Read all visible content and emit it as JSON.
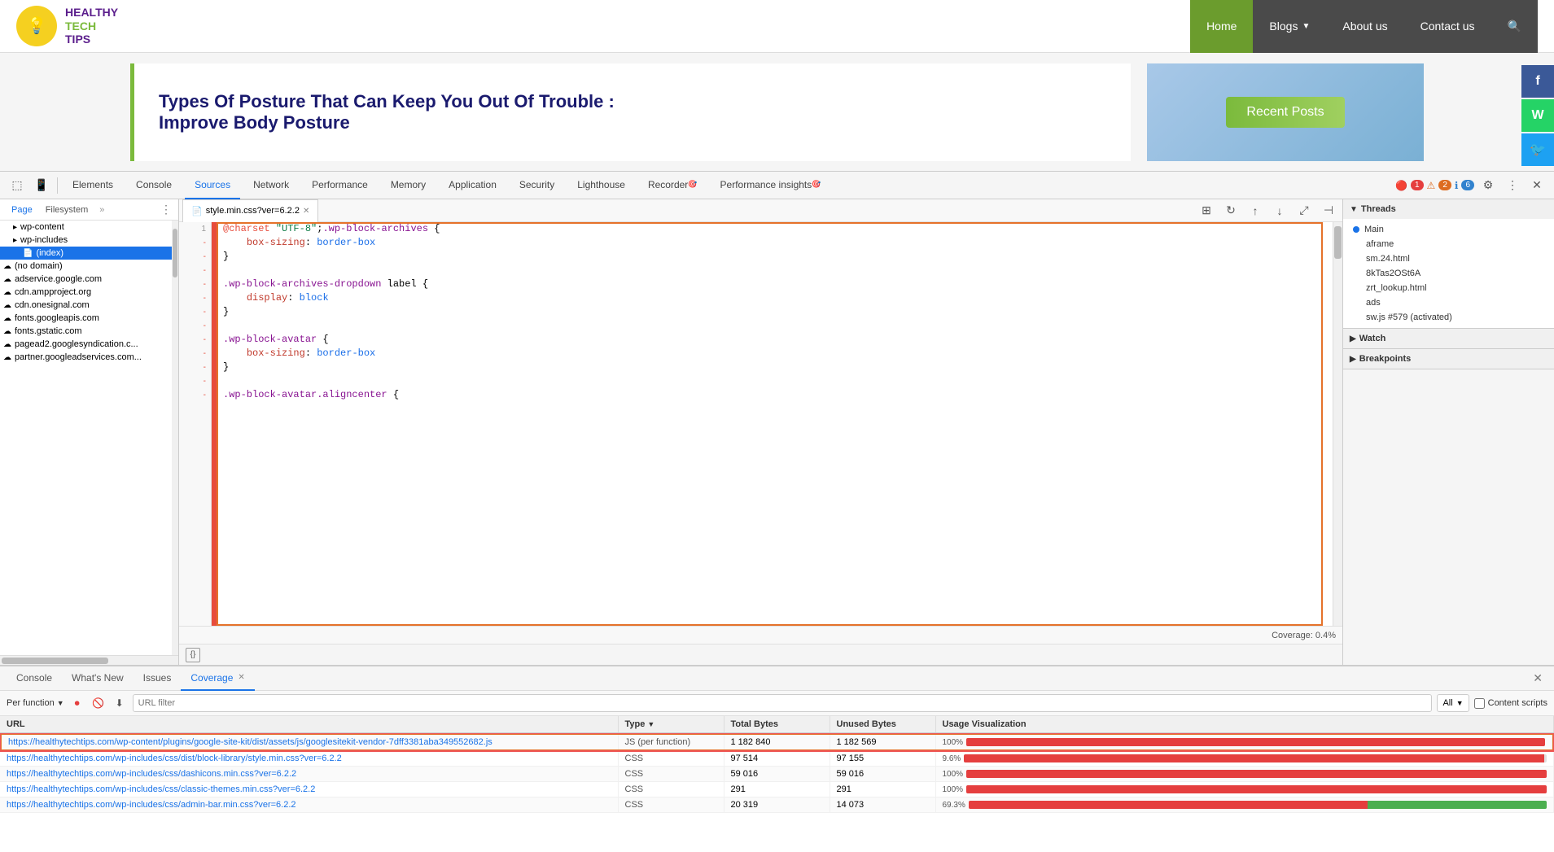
{
  "website": {
    "logo": {
      "icon": "💡",
      "line1": "HEALTHY",
      "line2": "TECH",
      "line3": "TIPS"
    },
    "nav": {
      "items": [
        {
          "label": "Home",
          "active": true
        },
        {
          "label": "Blogs",
          "hasDropdown": true
        },
        {
          "label": "About us",
          "active": false
        },
        {
          "label": "Contact us",
          "active": false
        }
      ],
      "search_icon": "🔍"
    },
    "article": {
      "title": "Types Of Posture That Can Keep You Out Of Trouble :",
      "subtitle": "Improve Body Posture"
    },
    "recent_posts_label": "Recent Posts"
  },
  "social": [
    {
      "label": "f",
      "type": "facebook"
    },
    {
      "label": "W",
      "type": "whatsapp"
    },
    {
      "label": "🐦",
      "type": "twitter"
    }
  ],
  "devtools": {
    "toolbar": {
      "inspect_icon": "⬚",
      "device_icon": "📱",
      "tabs": [
        "Elements",
        "Console",
        "Sources",
        "Network",
        "Performance",
        "Memory",
        "Application",
        "Security",
        "Lighthouse",
        "Recorder",
        "Performance insights"
      ],
      "active_tab": "Sources",
      "errors": "1",
      "warnings": "2",
      "info": "6",
      "settings_icon": "⚙",
      "more_icon": "⋮",
      "close_icon": "✕"
    },
    "file_tree": {
      "tabs": [
        "Page",
        "Filesystem"
      ],
      "items": [
        {
          "label": "wp-content",
          "depth": 1,
          "type": "folder",
          "expanded": true
        },
        {
          "label": "wp-includes",
          "depth": 1,
          "type": "folder",
          "expanded": true
        },
        {
          "label": "(index)",
          "depth": 2,
          "type": "file",
          "selected": true
        },
        {
          "label": "(no domain)",
          "depth": 0,
          "type": "cloud"
        },
        {
          "label": "adservice.google.com",
          "depth": 0,
          "type": "cloud"
        },
        {
          "label": "cdn.ampproject.org",
          "depth": 0,
          "type": "cloud"
        },
        {
          "label": "cdn.onesignal.com",
          "depth": 0,
          "type": "cloud"
        },
        {
          "label": "fonts.googleapis.com",
          "depth": 0,
          "type": "cloud"
        },
        {
          "label": "fonts.gstatic.com",
          "depth": 0,
          "type": "cloud"
        },
        {
          "label": "pagead2.googlesyndication.c...",
          "depth": 0,
          "type": "cloud"
        },
        {
          "label": "partner.googleadservices.com...",
          "depth": 0,
          "type": "cloud"
        }
      ]
    },
    "code_editor": {
      "tab_label": "style.min.css?ver=6.2.2",
      "lines": [
        {
          "num": 1,
          "marker": "-",
          "code": "@charset \"UTF-8\";.wp-block-archives {",
          "parts": [
            {
              "text": "@charset ",
              "cls": "kw-charset"
            },
            {
              "text": "\"UTF-8\"",
              "cls": "kw-string"
            },
            {
              "text": ";",
              "cls": ""
            },
            {
              "text": ".wp-block-archives",
              "cls": "kw-selector"
            },
            {
              "text": " {",
              "cls": "kw-brace"
            }
          ]
        },
        {
          "num": 2,
          "marker": "-",
          "code": "    box-sizing: border-box",
          "parts": [
            {
              "text": "    ",
              "cls": ""
            },
            {
              "text": "box-sizing",
              "cls": "kw-property"
            },
            {
              "text": ": ",
              "cls": ""
            },
            {
              "text": "border-box",
              "cls": "kw-value"
            }
          ]
        },
        {
          "num": 3,
          "marker": "-",
          "code": "}",
          "parts": [
            {
              "text": "}",
              "cls": "kw-brace"
            }
          ]
        },
        {
          "num": "",
          "marker": "-",
          "code": "",
          "parts": []
        },
        {
          "num": "",
          "marker": "-",
          "code": ".wp-block-archives-dropdown label {",
          "parts": [
            {
              "text": ".wp-block-archives-dropdown",
              "cls": "kw-selector"
            },
            {
              "text": " label",
              "cls": "kw-selector"
            },
            {
              "text": " {",
              "cls": "kw-brace"
            }
          ]
        },
        {
          "num": "",
          "marker": "-",
          "code": "    display: block",
          "parts": [
            {
              "text": "    ",
              "cls": ""
            },
            {
              "text": "display",
              "cls": "kw-property"
            },
            {
              "text": ": ",
              "cls": ""
            },
            {
              "text": "block",
              "cls": "kw-value"
            }
          ]
        },
        {
          "num": "",
          "marker": "-",
          "code": "}",
          "parts": [
            {
              "text": "}",
              "cls": "kw-brace"
            }
          ]
        },
        {
          "num": "",
          "marker": "-",
          "code": "",
          "parts": []
        },
        {
          "num": "",
          "marker": "-",
          "code": ".wp-block-avatar {",
          "parts": [
            {
              "text": ".wp-block-avatar",
              "cls": "kw-selector"
            },
            {
              "text": " {",
              "cls": "kw-brace"
            }
          ]
        },
        {
          "num": "",
          "marker": "-",
          "code": "    box-sizing: border-box",
          "parts": [
            {
              "text": "    ",
              "cls": ""
            },
            {
              "text": "box-sizing",
              "cls": "kw-property"
            },
            {
              "text": ": ",
              "cls": ""
            },
            {
              "text": "border-box",
              "cls": "kw-value"
            }
          ]
        },
        {
          "num": "",
          "marker": "-",
          "code": "}",
          "parts": [
            {
              "text": "}",
              "cls": "kw-brace"
            }
          ]
        },
        {
          "num": "",
          "marker": "-",
          "code": "",
          "parts": []
        },
        {
          "num": "",
          "marker": "-",
          "code": ".wp-block-avatar.aligncenter {",
          "parts": [
            {
              "text": ".wp-block-avatar.aligncenter",
              "cls": "kw-selector"
            },
            {
              "text": " {",
              "cls": "kw-brace"
            }
          ]
        }
      ],
      "coverage_label": "Coverage: 0.4%",
      "format_icon": "{}"
    },
    "right_panel": {
      "threads": {
        "label": "Threads",
        "items": [
          "Main",
          "aframe",
          "sm.24.html",
          "8kTas2OSt6A",
          "zrt_lookup.html",
          "ads",
          "sw.js #579 (activated)"
        ]
      },
      "watch": {
        "label": "Watch"
      },
      "breakpoints": {
        "label": "Breakpoints"
      }
    }
  },
  "bottom_panel": {
    "tabs": [
      "Console",
      "What's New",
      "Issues",
      "Coverage"
    ],
    "active_tab": "Coverage",
    "toolbar": {
      "per_function_label": "Per function",
      "record_icon": "⏺",
      "clear_icon": "🚫",
      "download_icon": "⬇",
      "filter_placeholder": "URL filter",
      "filter_all": "All",
      "content_scripts_label": "Content scripts"
    },
    "table": {
      "headers": [
        "URL",
        "Type",
        "Total Bytes",
        "Unused Bytes",
        "Usage Visualization"
      ],
      "rows": [
        {
          "url": "https://healthytechtips.com/wp-content/plugins/google-site-kit/dist/assets/js/googlesitekit-vendor-7dff3381aba349552682.js",
          "type": "JS (per function)",
          "total_bytes": "1 182 840",
          "unused_bytes": "1 182 569",
          "unused_pct": 100,
          "highlighted": true
        },
        {
          "url": "https://healthytechtips.com/wp-includes/css/dist/block-library/style.min.css?ver=6.2.2",
          "type": "CSS",
          "total_bytes": "97 514",
          "unused_bytes": "97 155",
          "unused_pct": 99.6,
          "highlighted": false
        },
        {
          "url": "https://healthytechtips.com/wp-includes/css/dashicons.min.css?ver=6.2.2",
          "type": "CSS",
          "total_bytes": "59 016",
          "unused_bytes": "59 016",
          "unused_pct": 100,
          "highlighted": false
        },
        {
          "url": "https://healthytechtips.com/wp-includes/css/classic-themes.min.css?ver=6.2.2",
          "type": "CSS",
          "total_bytes": "291",
          "unused_bytes": "291",
          "unused_pct": 100,
          "highlighted": false
        },
        {
          "url": "https://healthytechtips.com/wp-includes/css/admin-bar.min.css?ver=6.2.2",
          "type": "CSS",
          "total_bytes": "20 319",
          "unused_bytes": "14 073",
          "unused_pct": 69.3,
          "highlighted": false
        }
      ]
    }
  }
}
